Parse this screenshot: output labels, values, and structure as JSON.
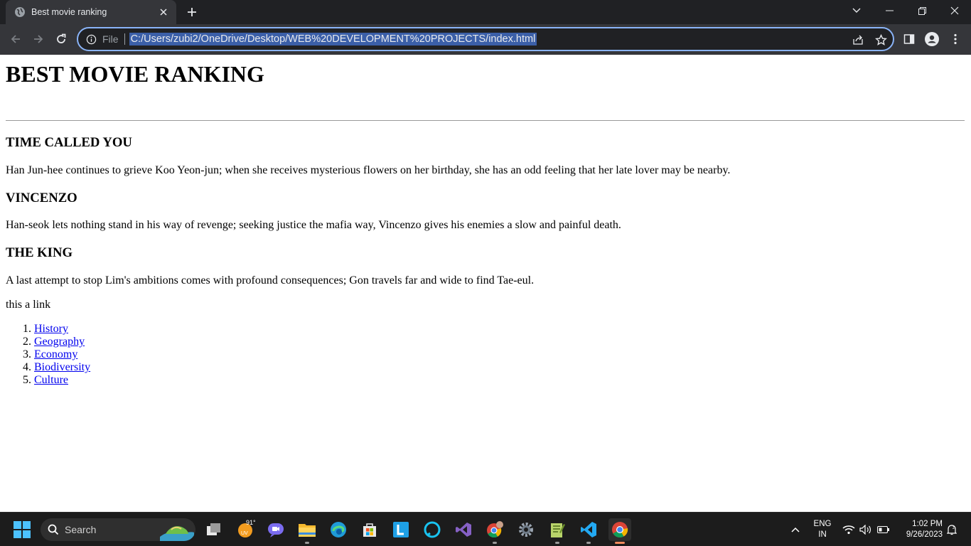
{
  "browser": {
    "tab": {
      "title": "Best movie ranking"
    },
    "address_bar": {
      "scheme_chip": "File",
      "url": "C:/Users/zubi2/OneDrive/Desktop/WEB%20DEVELOPMENT%20PROJECTS/index.html"
    }
  },
  "page": {
    "title": "BEST MOVIE RANKING",
    "sections": [
      {
        "heading": "TIME CALLED YOU",
        "text": "Han Jun-hee continues to grieve Koo Yeon-jun; when she receives mysterious flowers on her birthday, she has an odd feeling that her late lover may be nearby."
      },
      {
        "heading": "VINCENZO",
        "text": "Han-seok lets nothing stand in his way of revenge; seeking justice the mafia way, Vincenzo gives his enemies a slow and painful death."
      },
      {
        "heading": "THE KING",
        "text": "A last attempt to stop Lim's ambitions comes with profound consequences; Gon travels far and wide to find Tae-eul."
      }
    ],
    "link_caption": "this a link",
    "links": [
      {
        "num": "1.",
        "label": "History"
      },
      {
        "num": "2.",
        "label": "Geography"
      },
      {
        "num": "3.",
        "label": "Economy"
      },
      {
        "num": "4.",
        "label": "Biodiversity"
      },
      {
        "num": "5.",
        "label": "Culture"
      }
    ]
  },
  "taskbar": {
    "search_label": "Search",
    "weather_temp": "91°",
    "language": {
      "line1": "ENG",
      "line2": "IN"
    },
    "clock": {
      "time": "1:02 PM",
      "date": "9/26/2023"
    }
  },
  "colors": {
    "chrome_dark": "#202124",
    "chrome_toolbar": "#35363a",
    "omnibox_focus": "#8ab4f8",
    "link": "#0000ee",
    "taskbar": "#1c1c1c"
  }
}
